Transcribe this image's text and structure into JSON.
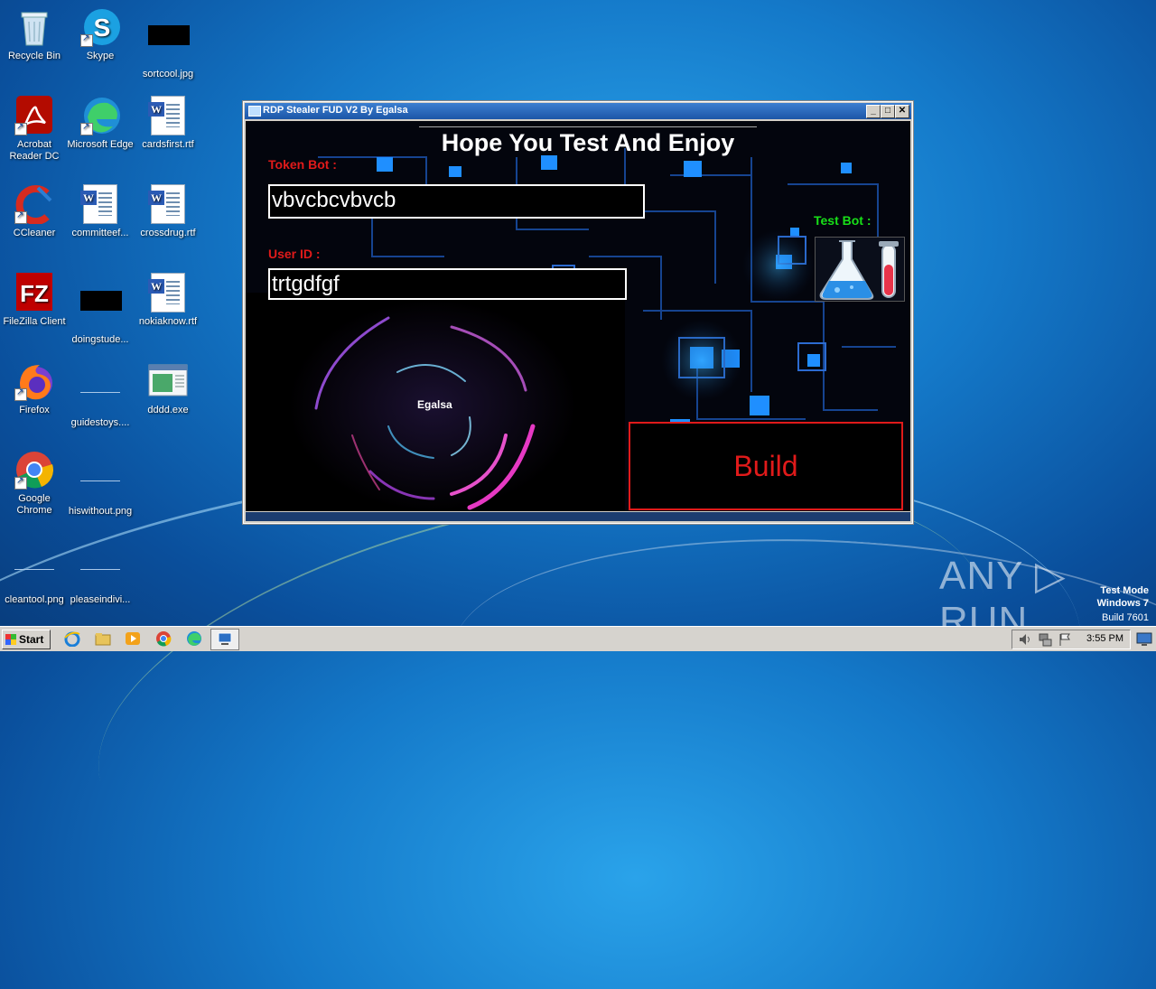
{
  "desktop": {
    "icons": [
      {
        "label": "Recycle Bin",
        "icon": "recycle-bin-icon"
      },
      {
        "label": "Skype",
        "icon": "skype-icon"
      },
      {
        "label": "sortcool.jpg",
        "icon": "image-file-icon"
      },
      {
        "label": "Acrobat Reader DC",
        "icon": "acrobat-icon"
      },
      {
        "label": "Microsoft Edge",
        "icon": "edge-icon"
      },
      {
        "label": "cardsfirst.rtf",
        "icon": "word-doc-icon"
      },
      {
        "label": "CCleaner",
        "icon": "ccleaner-icon"
      },
      {
        "label": "committeef...",
        "icon": "word-doc-icon"
      },
      {
        "label": "crossdrug.rtf",
        "icon": "word-doc-icon"
      },
      {
        "label": "FileZilla Client",
        "icon": "filezilla-icon"
      },
      {
        "label": "doingstude...",
        "icon": "image-file-icon"
      },
      {
        "label": "nokiaknow.rtf",
        "icon": "word-doc-icon"
      },
      {
        "label": "Firefox",
        "icon": "firefox-icon"
      },
      {
        "label": "guidestoys....",
        "icon": "blank-file-icon"
      },
      {
        "label": "dddd.exe",
        "icon": "exe-file-icon"
      },
      {
        "label": "Google Chrome",
        "icon": "chrome-icon"
      },
      {
        "label": "hiswithout.png",
        "icon": "blank-file-icon"
      },
      {
        "label": "cleantool.png",
        "icon": "blank-file-icon"
      },
      {
        "label": "pleaseindivi...",
        "icon": "blank-file-icon"
      }
    ]
  },
  "window": {
    "title": "RDP Stealer FUD V2 By Egalsa",
    "minimize": "_",
    "maximize": "□",
    "close": "✕",
    "headline": "Hope You Test And Enjoy",
    "token_label": "Token Bot :",
    "token_value": "vbvcbcvbvcb",
    "userid_label": "User ID :",
    "userid_value": "trtgdfgf",
    "testbot_label": "Test Bot :",
    "vortex_label": "Egalsa",
    "build_label": "Build"
  },
  "taskbar": {
    "start_label": "Start",
    "clock": "3:55 PM"
  },
  "watermark": {
    "line1": "Test Mode",
    "line2": "Windows 7",
    "line3": "Build 7601",
    "brand": "ANY ▷ RUN"
  },
  "colors": {
    "accent_red": "#e01a1a",
    "accent_green": "#18e018"
  }
}
